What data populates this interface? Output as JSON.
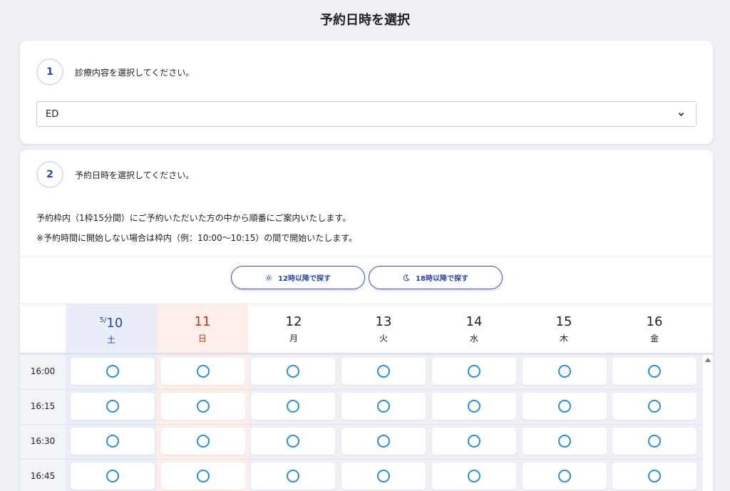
{
  "page": {
    "title": "予約日時を選択"
  },
  "step1": {
    "number": "1",
    "label": "診療内容を選択してください。",
    "selected_value": "ED",
    "icon": "chevron-down-icon"
  },
  "step2": {
    "number": "2",
    "label": "予約日時を選択してください。",
    "notice_line1": "予約枠内（1枠15分間）にご予約いただいた方の中から順番にご案内いたします。",
    "notice_line2": "※予約時間に開始しない場合は枠内（例：10:00〜10:15）の間で開始いたします。"
  },
  "filters": [
    {
      "label": "12時以降で探す",
      "icon": "sun-icon"
    },
    {
      "label": "18時以降で探す",
      "icon": "moon-icon"
    }
  ],
  "days": [
    {
      "month": "5/",
      "day": "10",
      "weekday": "土",
      "type": "sat"
    },
    {
      "month": "",
      "day": "11",
      "weekday": "日",
      "type": "sun"
    },
    {
      "month": "",
      "day": "12",
      "weekday": "月",
      "type": "weekday"
    },
    {
      "month": "",
      "day": "13",
      "weekday": "火",
      "type": "weekday"
    },
    {
      "month": "",
      "day": "14",
      "weekday": "水",
      "type": "weekday"
    },
    {
      "month": "",
      "day": "15",
      "weekday": "木",
      "type": "weekday"
    },
    {
      "month": "",
      "day": "16",
      "weekday": "金",
      "type": "weekday"
    }
  ],
  "times": [
    "16:00",
    "16:15",
    "16:30",
    "16:45"
  ],
  "slot_mark": "available-circle-icon",
  "colors": {
    "accent": "#2946a3",
    "available": "#2a8fd6",
    "sunday": "#d12b1c",
    "saturday_bg": "#e9edf8",
    "sunday_bg": "#fdeeea"
  }
}
